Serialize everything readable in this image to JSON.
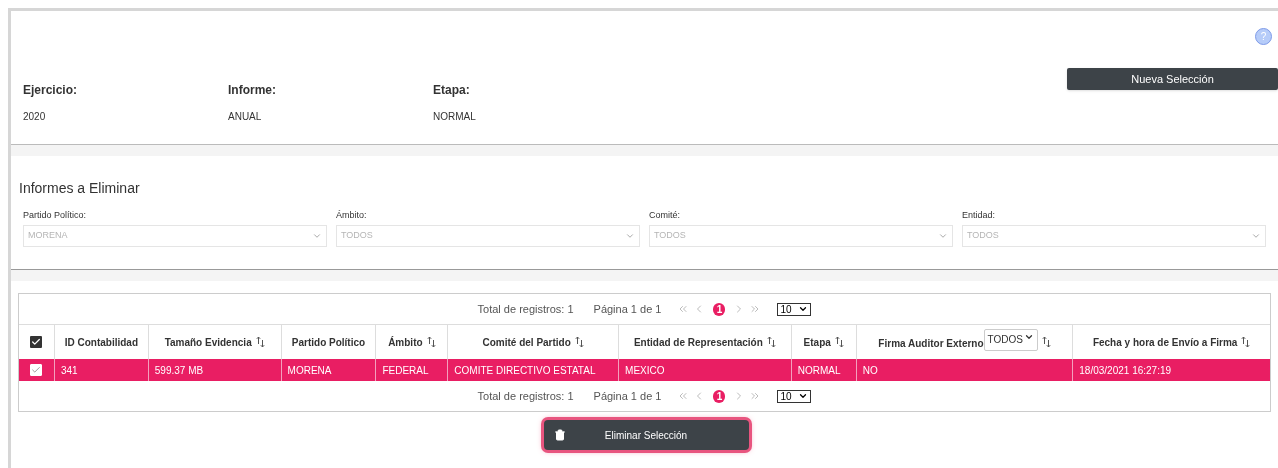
{
  "help": {
    "symbol": "?"
  },
  "header": {
    "fields": [
      {
        "label": "Ejercicio:",
        "value": "2020"
      },
      {
        "label": "Informe:",
        "value": "ANUAL"
      },
      {
        "label": "Etapa:",
        "value": "NORMAL"
      }
    ],
    "new_button": "Nueva Selección"
  },
  "filters": {
    "title": "Informes a Eliminar",
    "fields": [
      {
        "label": "Partido Político:",
        "value": "MORENA",
        "disabled": true
      },
      {
        "label": "Ámbito:",
        "value": "TODOS",
        "disabled": true
      },
      {
        "label": "Comité:",
        "value": "TODOS",
        "disabled": true
      },
      {
        "label": "Entidad:",
        "value": "TODOS",
        "disabled": true
      }
    ]
  },
  "table": {
    "pagination_top": {
      "total": "Total de registros: 1",
      "page": "Página 1 de 1",
      "current": "1",
      "page_size": "10"
    },
    "header_checked": true,
    "columns": [
      {
        "label": "ID Contabilidad",
        "sortable": false
      },
      {
        "label": "Tamaño Evidencia",
        "sortable": true
      },
      {
        "label": "Partido Político",
        "sortable": false
      },
      {
        "label": "Ámbito",
        "sortable": true
      },
      {
        "label": "Comité del Partido",
        "sortable": true
      },
      {
        "label": "Entidad de Representación",
        "sortable": true
      },
      {
        "label": "Etapa",
        "sortable": true
      },
      {
        "label": "Firma Auditor Externo",
        "sortable": true,
        "filter": "TODOS"
      },
      {
        "label": "Fecha y hora de Envío a Firma",
        "sortable": true
      }
    ],
    "rows": [
      {
        "checked": true,
        "selected": true,
        "cells": [
          "341",
          "599.37 MB",
          "MORENA",
          "FEDERAL",
          "COMITE DIRECTIVO ESTATAL",
          "MEXICO",
          "NORMAL",
          "NO",
          "18/03/2021 16:27:19"
        ]
      }
    ],
    "pagination_bottom": {
      "total": "Total de registros: 1",
      "page": "Página 1 de 1",
      "current": "1",
      "page_size": "10"
    }
  },
  "delete_button": {
    "label": "Eliminar Selección",
    "highlighted": true
  }
}
